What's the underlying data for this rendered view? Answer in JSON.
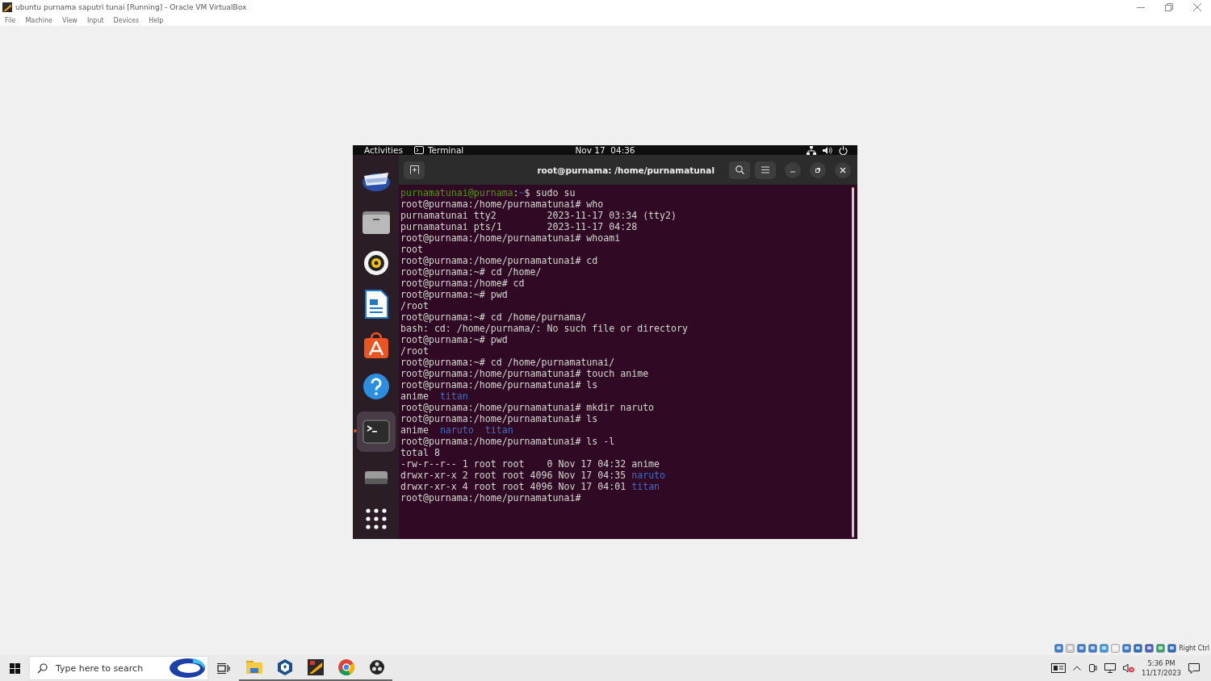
{
  "window": {
    "title": "ubuntu purnama saputri tunai [Running] - Oracle VM VirtualBox"
  },
  "menu": [
    "File",
    "Machine",
    "View",
    "Input",
    "Devices",
    "Help"
  ],
  "guest": {
    "top_bar": {
      "activities": "Activities",
      "app": "Terminal",
      "clock": "Nov 17  04:36"
    },
    "dock": [
      {
        "kind": "mail",
        "selected": false
      },
      {
        "kind": "files",
        "selected": false
      },
      {
        "kind": "music",
        "selected": false
      },
      {
        "kind": "writer",
        "selected": false
      },
      {
        "kind": "store",
        "selected": false
      },
      {
        "kind": "help",
        "selected": false
      },
      {
        "kind": "terminal",
        "selected": true
      },
      {
        "kind": "drive",
        "selected": false
      },
      {
        "kind": "apps",
        "selected": false
      }
    ],
    "terminal": {
      "title": "root@purnama: /home/purnamatunal",
      "lines": [
        [
          {
            "kind": "user",
            "text": "purnamatunai@purnama"
          },
          {
            "kind": "plain",
            "text": ":"
          },
          {
            "kind": "path",
            "text": "~"
          },
          {
            "kind": "plain",
            "text": "$ sudo su"
          }
        ],
        [
          {
            "kind": "plain",
            "text": "root@purnama:/home/purnamatunai# who"
          }
        ],
        [
          {
            "kind": "plain",
            "text": "purnamatunai tty2         2023-11-17 03:34 (tty2)"
          }
        ],
        [
          {
            "kind": "plain",
            "text": "purnamatunai pts/1        2023-11-17 04:28"
          }
        ],
        [
          {
            "kind": "plain",
            "text": "root@purnama:/home/purnamatunai# whoami"
          }
        ],
        [
          {
            "kind": "plain",
            "text": "root"
          }
        ],
        [
          {
            "kind": "plain",
            "text": "root@purnama:/home/purnamatunai# cd"
          }
        ],
        [
          {
            "kind": "plain",
            "text": "root@purnama:~# cd /home/"
          }
        ],
        [
          {
            "kind": "plain",
            "text": "root@purnama:/home# cd"
          }
        ],
        [
          {
            "kind": "plain",
            "text": "root@purnama:~# pwd"
          }
        ],
        [
          {
            "kind": "plain",
            "text": "/root"
          }
        ],
        [
          {
            "kind": "plain",
            "text": "root@purnama:~# cd /home/purnama/"
          }
        ],
        [
          {
            "kind": "plain",
            "text": "bash: cd: /home/purnama/: No such file or directory"
          }
        ],
        [
          {
            "kind": "plain",
            "text": "root@purnama:~# pwd"
          }
        ],
        [
          {
            "kind": "plain",
            "text": "/root"
          }
        ],
        [
          {
            "kind": "plain",
            "text": "root@purnama:~# cd /home/purnamatunai/"
          }
        ],
        [
          {
            "kind": "plain",
            "text": "root@purnama:/home/purnamatunai# touch anime"
          }
        ],
        [
          {
            "kind": "plain",
            "text": "root@purnama:/home/purnamatunai# ls"
          }
        ],
        [
          {
            "kind": "plain",
            "text": "anime  "
          },
          {
            "kind": "dir",
            "text": "titan"
          }
        ],
        [
          {
            "kind": "plain",
            "text": "root@purnama:/home/purnamatunai# mkdir naruto"
          }
        ],
        [
          {
            "kind": "plain",
            "text": "root@purnama:/home/purnamatunai# ls"
          }
        ],
        [
          {
            "kind": "plain",
            "text": "anime  "
          },
          {
            "kind": "dir",
            "text": "naruto  "
          },
          {
            "kind": "dir",
            "text": "titan"
          }
        ],
        [
          {
            "kind": "plain",
            "text": "root@purnama:/home/purnamatunai# ls -l"
          }
        ],
        [
          {
            "kind": "plain",
            "text": "total 8"
          }
        ],
        [
          {
            "kind": "plain",
            "text": "-rw-r--r-- 1 root root    0 Nov 17 04:32 anime"
          }
        ],
        [
          {
            "kind": "plain",
            "text": "drwxr-xr-x 2 root root 4096 Nov 17 04:35 "
          },
          {
            "kind": "dir",
            "text": "naruto"
          }
        ],
        [
          {
            "kind": "plain",
            "text": "drwxr-xr-x 4 root root 4096 Nov 17 04:01 "
          },
          {
            "kind": "dir",
            "text": "titan"
          }
        ],
        [
          {
            "kind": "plain",
            "text": "root@purnama:/home/purnamatunai#"
          }
        ]
      ]
    }
  },
  "vm_status": {
    "host_key": "Right Ctrl"
  },
  "taskbar": {
    "search": {
      "placeholder": "Type here to search"
    },
    "apps": [
      {
        "kind": "folder",
        "running": true
      },
      {
        "kind": "cube",
        "running": true
      },
      {
        "kind": "editor",
        "running": true
      },
      {
        "kind": "browser",
        "running": true
      },
      {
        "kind": "recorder",
        "running": true
      }
    ],
    "time": "5:36 PM",
    "date": "11/17/2023"
  }
}
